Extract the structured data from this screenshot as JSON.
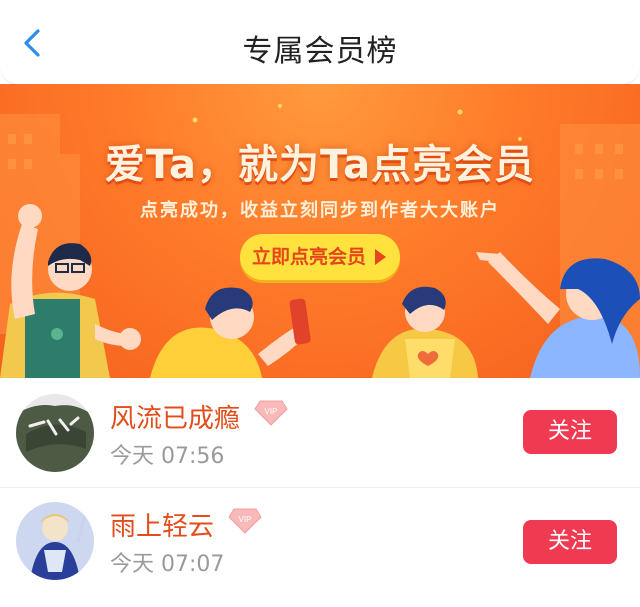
{
  "header": {
    "title": "专属会员榜"
  },
  "banner": {
    "headline": "爱Ta，就为Ta点亮会员",
    "subtitle": "点亮成功，收益立刻同步到作者大大账户",
    "cta_label": "立即点亮会员"
  },
  "members": [
    {
      "name": "风流已成瘾",
      "badge": "VIP",
      "time": "今天 07:56",
      "follow_label": "关注"
    },
    {
      "name": "雨上轻云",
      "badge": "VIP",
      "time": "今天 07:07",
      "follow_label": "关注"
    }
  ],
  "colors": {
    "accent_orange": "#f4601e",
    "follow_red": "#ef3a52",
    "name_color": "#e24d1b",
    "back_blue": "#2b8df3"
  }
}
